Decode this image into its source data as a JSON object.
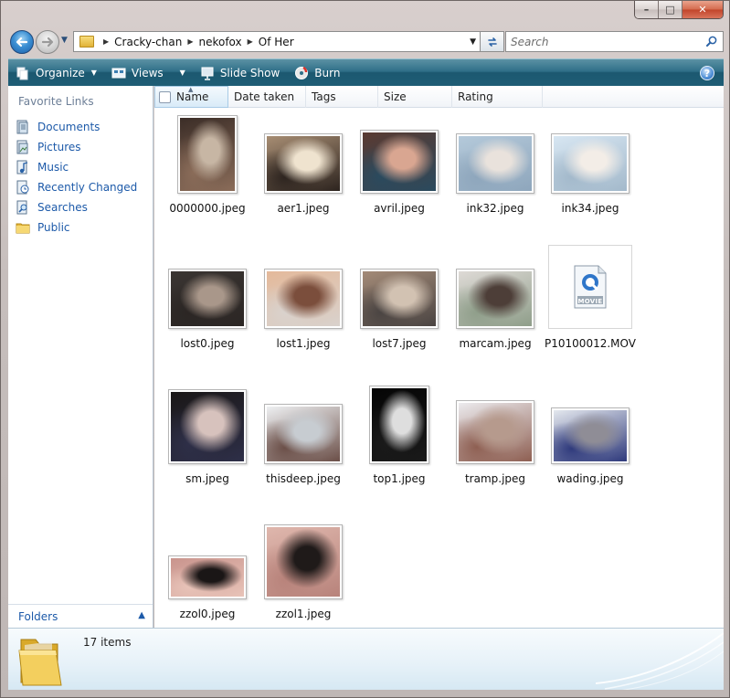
{
  "window": {
    "caption_buttons": {
      "minimize": "–",
      "maximize": "□",
      "close": "✕"
    }
  },
  "navigation": {
    "back_icon": "back-arrow-icon",
    "forward_icon": "forward-arrow-icon",
    "breadcrumbs": [
      "Cracky-chan",
      "nekofox",
      "Of Her"
    ],
    "search_placeholder": "Search"
  },
  "toolbar": {
    "organize": "Organize",
    "views": "Views",
    "slideshow": "Slide Show",
    "burn": "Burn",
    "help": "?"
  },
  "sidebar": {
    "title": "Favorite Links",
    "items": [
      {
        "label": "Documents",
        "icon": "documents-icon"
      },
      {
        "label": "Pictures",
        "icon": "pictures-icon"
      },
      {
        "label": "Music",
        "icon": "music-icon"
      },
      {
        "label": "Recently Changed",
        "icon": "recently-changed-icon"
      },
      {
        "label": "Searches",
        "icon": "searches-icon"
      },
      {
        "label": "Public",
        "icon": "public-folder-icon"
      }
    ],
    "folders_label": "Folders"
  },
  "columns": [
    "Name",
    "Date taken",
    "Tags",
    "Size",
    "Rating"
  ],
  "files": [
    {
      "name": "0000000.jpeg",
      "colors": [
        "#3b2d27",
        "#c7b6a4",
        "#8a6c59"
      ]
    },
    {
      "name": "aer1.jpeg",
      "colors": [
        "#a78d73",
        "#efe3cf",
        "#2d241f"
      ]
    },
    {
      "name": "avril.jpeg",
      "colors": [
        "#5a3a31",
        "#d9a691",
        "#2a4a5e"
      ]
    },
    {
      "name": "ink32.jpeg",
      "colors": [
        "#b4c9da",
        "#e9e2dc",
        "#8ea6bc"
      ]
    },
    {
      "name": "ink34.jpeg",
      "colors": [
        "#d7e6f2",
        "#f3ede7",
        "#a3b9cb"
      ]
    },
    {
      "name": "lost0.jpeg",
      "colors": [
        "#3a3532",
        "#a9978a",
        "#2b2624"
      ]
    },
    {
      "name": "lost1.jpeg",
      "colors": [
        "#e4b99a",
        "#7b4e3c",
        "#d9d2cd"
      ]
    },
    {
      "name": "lost7.jpeg",
      "colors": [
        "#a48b78",
        "#d2c2b2",
        "#4a4442"
      ]
    },
    {
      "name": "marcam.jpeg",
      "colors": [
        "#dedad6",
        "#4d3e38",
        "#8f9e8a"
      ]
    },
    {
      "name": "P10100012.MOV",
      "colors": [
        "#ffffff"
      ],
      "is_video": true,
      "video_badge": "MOVIE"
    },
    {
      "name": "sm.jpeg",
      "colors": [
        "#1a1717",
        "#d7c2bd",
        "#2e2f48"
      ]
    },
    {
      "name": "thisdeep.jpeg",
      "colors": [
        "#eef0f2",
        "#c7ccd1",
        "#6b4f48"
      ]
    },
    {
      "name": "top1.jpeg",
      "colors": [
        "#050505",
        "#dedede",
        "#1a1a1a"
      ]
    },
    {
      "name": "tramp.jpeg",
      "colors": [
        "#ecebee",
        "#b69a8d",
        "#8e5f52"
      ]
    },
    {
      "name": "wading.jpeg",
      "colors": [
        "#e4e8ee",
        "#8f8d96",
        "#2f3a7c"
      ]
    },
    {
      "name": "zzol0.jpeg",
      "colors": [
        "#c9948d",
        "#1a1616",
        "#e8c3b8"
      ]
    },
    {
      "name": "zzol1.jpeg",
      "colors": [
        "#dfb7ad",
        "#1f1a19",
        "#b8837b"
      ]
    }
  ],
  "details": {
    "count_text": "17 items"
  },
  "accent": {
    "commandbar": "#2f6f88",
    "link": "#1d5aa9"
  }
}
